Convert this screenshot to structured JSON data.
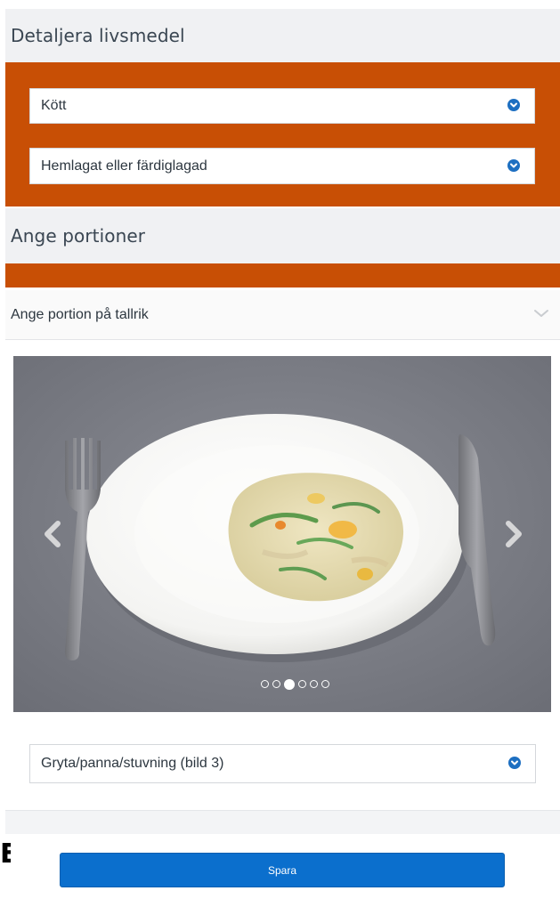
{
  "details": {
    "title": "Detaljera livsmedel",
    "category_select": {
      "value": "Kött",
      "icon": "chevron-down-icon"
    },
    "preparation_select": {
      "value": "Hemlagat eller färdiglagad",
      "icon": "chevron-down-icon"
    }
  },
  "portions": {
    "title": "Ange portioner",
    "accordion_label": "Ange portion på tallrik",
    "carousel": {
      "image_count": 6,
      "active_index": 3,
      "prev_icon": "chevron-left-icon",
      "next_icon": "chevron-right-icon"
    },
    "dish_select": {
      "value": "Gryta/panna/stuvning (bild 3)",
      "icon": "chevron-down-icon"
    }
  },
  "left_fragment": "E",
  "save_label": "Spara",
  "colors": {
    "accent_orange": "#c84f05",
    "primary_blue": "#0b6fcd",
    "header_bg": "#f0f1f3"
  }
}
